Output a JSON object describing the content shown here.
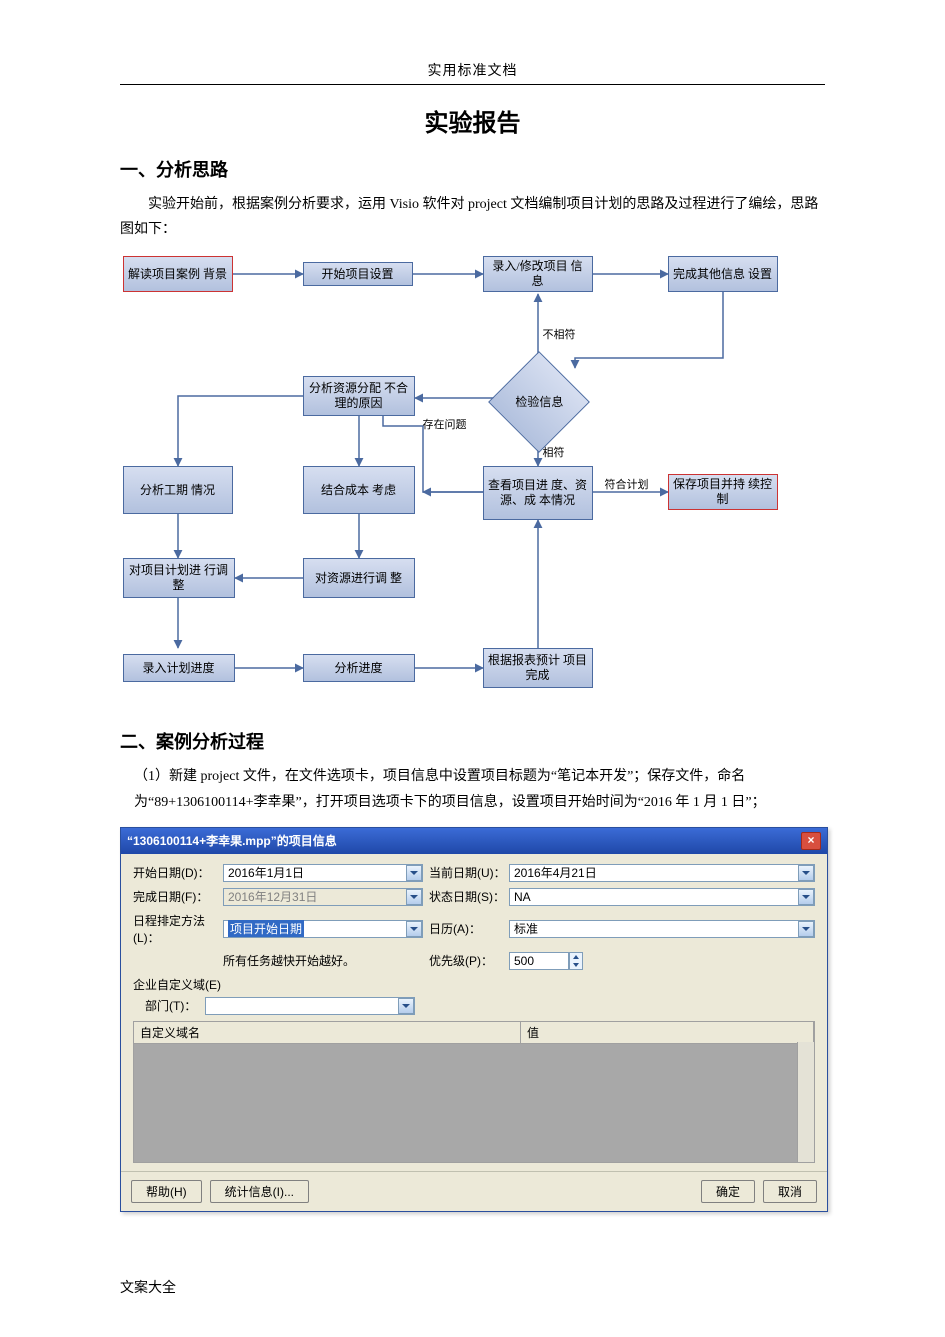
{
  "header_small": "实用标准文档",
  "title": "实验报告",
  "section1_head": "一、分析思路",
  "section1_para": "实验开始前，根据案例分析要求，运用 Visio 软件对 project 文档编制项目计划的思路及过程进行了编绘，思路图如下：",
  "flow": {
    "b1": "解读项目案例\n背景",
    "b2": "开始项目设置",
    "b3": "录入/修改项目\n信息",
    "b4": "完成其他信息\n设置",
    "d1": "检验信息",
    "b5": "分析资源分配\n不合理的原因",
    "b6": "查看项目进\n度、资源、成\n本情况",
    "b7": "保存项目并持\n续控制",
    "b8": "分析工期\n情况",
    "b9": "结合成本\n考虑",
    "b10": "对项目计划进\n行调整",
    "b11": "对资源进行调\n整",
    "b12": "录入计划进度",
    "b13": "分析进度",
    "b14": "根据报表预计\n项目完成",
    "e_mismatch": "不相符",
    "e_match": "相符",
    "e_problem": "存在问题",
    "e_plan": "符合计划"
  },
  "section2_head": "二、案例分析过程",
  "section2_item1": "（1）新建 project 文件，在文件选项卡，项目信息中设置项目标题为“笔记本开发”；保存文件，命名为“89+1306100114+李幸果”，打开项目选项卡下的项目信息，设置项目开始时间为“2016 年 1 月 1 日”；",
  "dialog": {
    "title": "“1306100114+李幸果.mpp”的项目信息",
    "labels": {
      "start": "开始日期(D)：",
      "finish": "完成日期(F)：",
      "schedule": "日程排定方法(L)：",
      "tasks_note": "所有任务越快开始越好。",
      "enterprise": "企业自定义域(E)",
      "dept": "部门(T)：",
      "current": "当前日期(U)：",
      "status": "状态日期(S)：",
      "calendar": "日历(A)：",
      "priority": "优先级(P)："
    },
    "values": {
      "start": "2016年1月1日",
      "finish": "2016年12月31日",
      "schedule": "项目开始日期",
      "current": "2016年4月21日",
      "status": "NA",
      "calendar": "标准",
      "priority": "500"
    },
    "table_headers": {
      "name": "自定义域名",
      "value": "值"
    },
    "buttons": {
      "help": "帮助(H)",
      "stats": "统计信息(I)...",
      "ok": "确定",
      "cancel": "取消"
    }
  },
  "footer": "文案大全"
}
